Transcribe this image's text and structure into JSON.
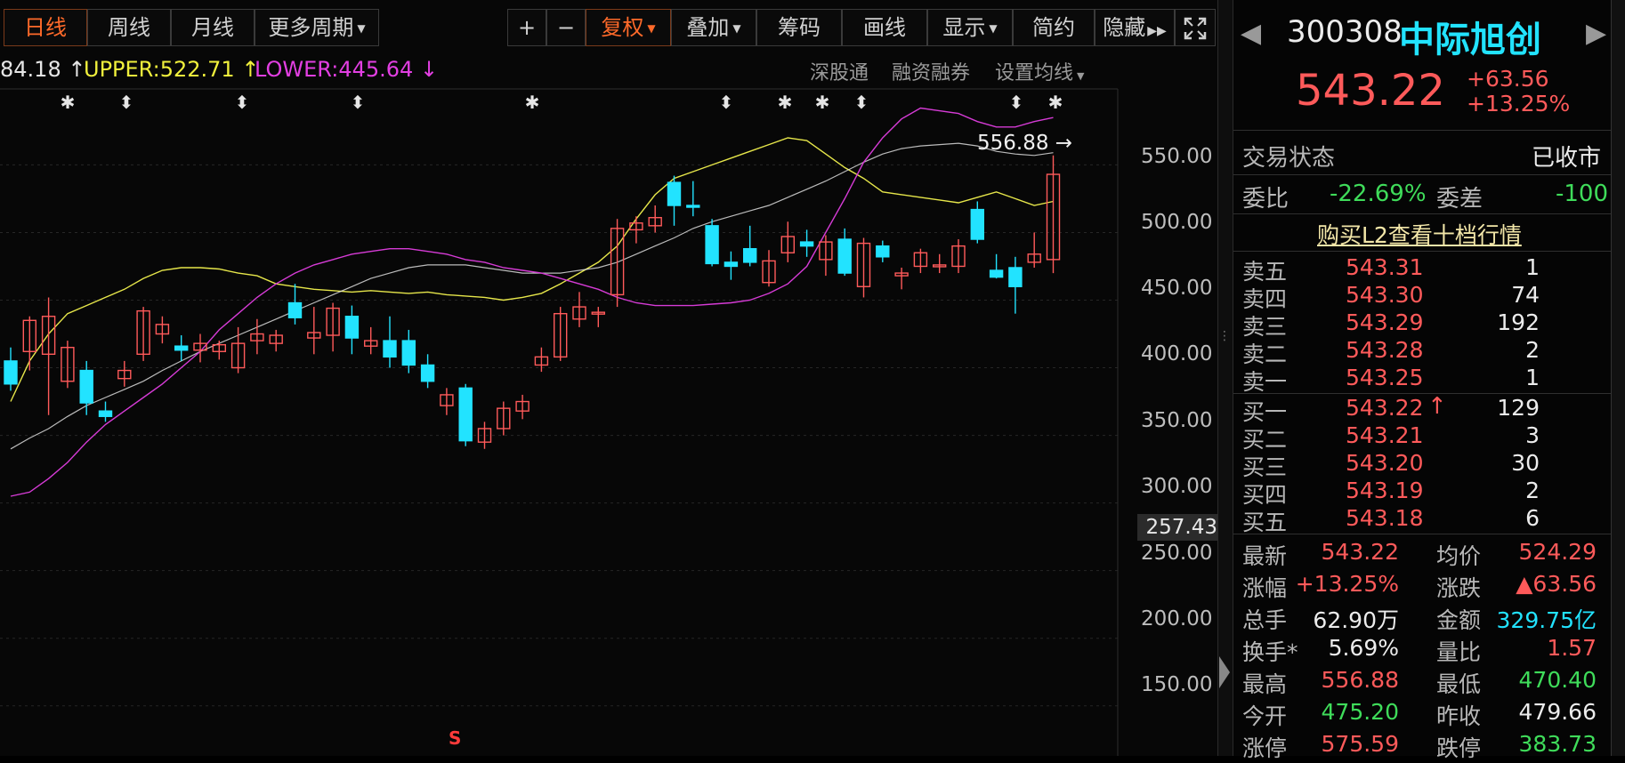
{
  "toolbar": {
    "periods": [
      "日线",
      "周线",
      "月线",
      "更多周期"
    ],
    "plus": "+",
    "minus": "−",
    "fuquan": "复权",
    "diejia": "叠加",
    "chouma": "筹码",
    "huaxian": "画线",
    "xianshi": "显示",
    "jianyue": "简约",
    "yincang": "隐藏"
  },
  "indicators": {
    "mid": "84.18",
    "upper": "UPPER:522.71",
    "lower": "LOWER:445.64"
  },
  "links": [
    "深股通",
    "融资融券",
    "设置均线"
  ],
  "chart_data": {
    "type": "candlestick",
    "y_ticks": [
      "550.00",
      "500.00",
      "450.00",
      "400.00",
      "350.00",
      "300.00",
      "250.00",
      "200.00",
      "150.00"
    ],
    "current_price_label": "257.43",
    "high_label": "556.88",
    "ylim": [
      113,
      593
    ],
    "candles": [
      {
        "o": 405,
        "h": 415,
        "l": 383,
        "c": 388
      },
      {
        "o": 412,
        "h": 438,
        "l": 398,
        "c": 435
      },
      {
        "o": 410,
        "h": 452,
        "l": 365,
        "c": 438
      },
      {
        "o": 390,
        "h": 420,
        "l": 385,
        "c": 415
      },
      {
        "o": 398,
        "h": 405,
        "l": 365,
        "c": 374
      },
      {
        "o": 368,
        "h": 375,
        "l": 360,
        "c": 364
      },
      {
        "o": 392,
        "h": 405,
        "l": 386,
        "c": 398
      },
      {
        "o": 410,
        "h": 445,
        "l": 405,
        "c": 442
      },
      {
        "o": 425,
        "h": 438,
        "l": 418,
        "c": 432
      },
      {
        "o": 416,
        "h": 424,
        "l": 405,
        "c": 413
      },
      {
        "o": 413,
        "h": 425,
        "l": 404,
        "c": 418
      },
      {
        "o": 412,
        "h": 420,
        "l": 406,
        "c": 417
      },
      {
        "o": 400,
        "h": 430,
        "l": 396,
        "c": 418
      },
      {
        "o": 420,
        "h": 436,
        "l": 410,
        "c": 425
      },
      {
        "o": 418,
        "h": 428,
        "l": 412,
        "c": 424
      },
      {
        "o": 448,
        "h": 462,
        "l": 432,
        "c": 437
      },
      {
        "o": 422,
        "h": 445,
        "l": 410,
        "c": 426
      },
      {
        "o": 424,
        "h": 448,
        "l": 412,
        "c": 444
      },
      {
        "o": 438,
        "h": 446,
        "l": 410,
        "c": 422
      },
      {
        "o": 416,
        "h": 430,
        "l": 410,
        "c": 420
      },
      {
        "o": 420,
        "h": 438,
        "l": 400,
        "c": 408
      },
      {
        "o": 420,
        "h": 428,
        "l": 396,
        "c": 402
      },
      {
        "o": 402,
        "h": 410,
        "l": 385,
        "c": 390
      },
      {
        "o": 372,
        "h": 385,
        "l": 365,
        "c": 380
      },
      {
        "o": 385,
        "h": 388,
        "l": 342,
        "c": 346
      },
      {
        "o": 345,
        "h": 360,
        "l": 340,
        "c": 355
      },
      {
        "o": 355,
        "h": 375,
        "l": 350,
        "c": 370
      },
      {
        "o": 368,
        "h": 380,
        "l": 362,
        "c": 375
      },
      {
        "o": 402,
        "h": 415,
        "l": 397,
        "c": 408
      },
      {
        "o": 408,
        "h": 445,
        "l": 405,
        "c": 440
      },
      {
        "o": 436,
        "h": 456,
        "l": 430,
        "c": 445
      },
      {
        "o": 440,
        "h": 445,
        "l": 430,
        "c": 441
      },
      {
        "o": 454,
        "h": 510,
        "l": 445,
        "c": 503
      },
      {
        "o": 502,
        "h": 512,
        "l": 492,
        "c": 507
      },
      {
        "o": 505,
        "h": 520,
        "l": 500,
        "c": 511
      },
      {
        "o": 537,
        "h": 542,
        "l": 505,
        "c": 520
      },
      {
        "o": 520,
        "h": 538,
        "l": 512,
        "c": 519
      },
      {
        "o": 505,
        "h": 510,
        "l": 475,
        "c": 477
      },
      {
        "o": 478,
        "h": 486,
        "l": 465,
        "c": 475
      },
      {
        "o": 488,
        "h": 505,
        "l": 475,
        "c": 478
      },
      {
        "o": 463,
        "h": 487,
        "l": 460,
        "c": 479
      },
      {
        "o": 485,
        "h": 508,
        "l": 478,
        "c": 497
      },
      {
        "o": 493,
        "h": 502,
        "l": 482,
        "c": 490
      },
      {
        "o": 480,
        "h": 498,
        "l": 468,
        "c": 493
      },
      {
        "o": 495,
        "h": 503,
        "l": 468,
        "c": 470
      },
      {
        "o": 460,
        "h": 496,
        "l": 452,
        "c": 492
      },
      {
        "o": 490,
        "h": 494,
        "l": 478,
        "c": 482
      },
      {
        "o": 468,
        "h": 474,
        "l": 458,
        "c": 470
      },
      {
        "o": 475,
        "h": 488,
        "l": 470,
        "c": 485
      },
      {
        "o": 475,
        "h": 484,
        "l": 470,
        "c": 476
      },
      {
        "o": 475,
        "h": 495,
        "l": 470,
        "c": 490
      },
      {
        "o": 517,
        "h": 523,
        "l": 492,
        "c": 495
      },
      {
        "o": 472,
        "h": 484,
        "l": 466,
        "c": 467
      },
      {
        "o": 474,
        "h": 482,
        "l": 440,
        "c": 460
      },
      {
        "o": 478,
        "h": 500,
        "l": 474,
        "c": 484
      },
      {
        "o": 480,
        "h": 557,
        "l": 470,
        "c": 543
      }
    ],
    "upper_band": [
      375,
      405,
      425,
      440,
      446,
      452,
      458,
      466,
      472,
      474,
      474,
      473,
      470,
      468,
      462,
      460,
      458,
      457,
      456,
      457,
      456,
      455,
      456,
      454,
      453,
      452,
      450,
      452,
      455,
      462,
      470,
      478,
      490,
      510,
      528,
      540,
      545,
      550,
      555,
      560,
      565,
      570,
      568,
      558,
      548,
      540,
      530,
      528,
      526,
      524,
      522,
      526,
      530,
      525,
      520,
      523
    ],
    "mid_band": [
      340,
      348,
      355,
      364,
      372,
      378,
      384,
      390,
      398,
      405,
      412,
      418,
      424,
      430,
      436,
      442,
      448,
      454,
      460,
      466,
      470,
      474,
      476,
      476,
      476,
      474,
      472,
      470,
      470,
      470,
      472,
      474,
      478,
      484,
      490,
      496,
      503,
      508,
      512,
      516,
      520,
      526,
      532,
      538,
      545,
      552,
      558,
      562,
      564,
      565,
      566,
      564,
      560,
      558,
      557,
      559
    ],
    "lower_band": [
      305,
      308,
      318,
      330,
      345,
      358,
      368,
      378,
      388,
      400,
      412,
      428,
      440,
      452,
      462,
      470,
      476,
      480,
      484,
      486,
      488,
      488,
      486,
      484,
      480,
      478,
      474,
      472,
      470,
      466,
      462,
      458,
      452,
      448,
      446,
      446,
      446,
      447,
      448,
      450,
      455,
      462,
      475,
      500,
      525,
      552,
      570,
      584,
      592,
      590,
      588,
      582,
      578,
      578,
      582,
      585
    ]
  },
  "panel": {
    "code": "300308",
    "name": "中际旭创",
    "price": "543.22",
    "change": "+63.56",
    "change_pct": "+13.25%",
    "status_label": "交易状态",
    "status_value": "已收市",
    "weibi_label": "委比",
    "weibi_value": "-22.69%",
    "weicha_label": "委差",
    "weicha_value": "-100",
    "l2_link": "购买L2查看十档行情",
    "asks": [
      {
        "label": "卖五",
        "price": "543.31",
        "vol": "1"
      },
      {
        "label": "卖四",
        "price": "543.30",
        "vol": "74"
      },
      {
        "label": "卖三",
        "price": "543.29",
        "vol": "192"
      },
      {
        "label": "卖二",
        "price": "543.28",
        "vol": "2"
      },
      {
        "label": "卖一",
        "price": "543.25",
        "vol": "1"
      }
    ],
    "bids": [
      {
        "label": "买一",
        "price": "543.22",
        "vol": "129"
      },
      {
        "label": "买二",
        "price": "543.21",
        "vol": "3"
      },
      {
        "label": "买三",
        "price": "543.20",
        "vol": "30"
      },
      {
        "label": "买四",
        "price": "543.19",
        "vol": "2"
      },
      {
        "label": "买五",
        "price": "543.18",
        "vol": "6"
      }
    ],
    "stats": [
      {
        "l1": "最新",
        "v1": "543.22",
        "c1": "red",
        "l2": "均价",
        "v2": "524.29",
        "c2": "red"
      },
      {
        "l1": "涨幅",
        "v1": "+13.25%",
        "c1": "red",
        "l2": "涨跌",
        "v2": "▲63.56",
        "c2": "red"
      },
      {
        "l1": "总手",
        "v1": "62.90万",
        "c1": "white",
        "l2": "金额",
        "v2": "329.75亿",
        "c2": "cyan"
      },
      {
        "l1": "换手*",
        "v1": "5.69%",
        "c1": "white",
        "l2": "量比",
        "v2": "1.57",
        "c2": "red"
      },
      {
        "l1": "最高",
        "v1": "556.88",
        "c1": "red",
        "l2": "最低",
        "v2": "470.40",
        "c2": "green"
      },
      {
        "l1": "今开",
        "v1": "475.20",
        "c1": "green",
        "l2": "昨收",
        "v2": "479.66",
        "c2": "white"
      },
      {
        "l1": "涨停",
        "v1": "575.59",
        "c1": "red",
        "l2": "跌停",
        "v2": "383.73",
        "c2": "green"
      }
    ]
  },
  "colors": {
    "up": "#ff5a5a",
    "down": "#22e3ff",
    "upper_band": "#e6e64a",
    "mid_band": "#e8e8e8",
    "lower_band": "#d63bd6"
  }
}
